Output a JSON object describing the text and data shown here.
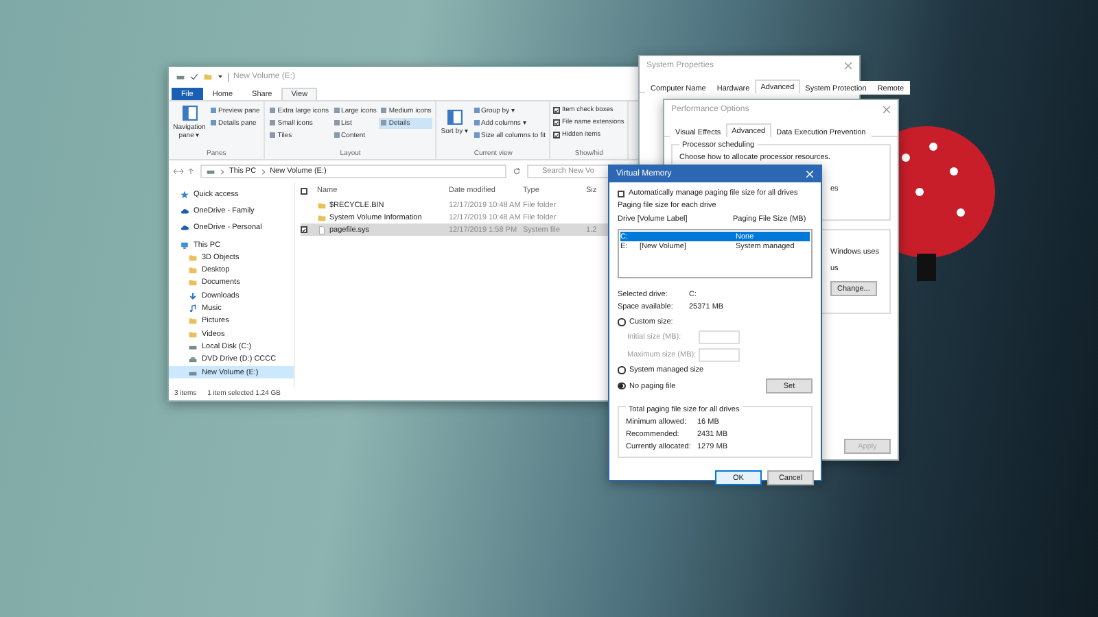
{
  "explorer": {
    "title": "New Volume (E:)",
    "ribbon_tabs": [
      {
        "label": "File",
        "kind": "file",
        "selected": false
      },
      {
        "label": "Home",
        "kind": "tab",
        "selected": false
      },
      {
        "label": "Share",
        "kind": "tab",
        "selected": false
      },
      {
        "label": "View",
        "kind": "tab",
        "selected": true
      }
    ],
    "ribbon_groups": [
      {
        "label": "Panes",
        "items": [
          {
            "kind": "big",
            "label": "Navigation pane ▾"
          },
          {
            "kind": "small",
            "label": "Preview pane"
          },
          {
            "kind": "small",
            "label": "Details pane"
          }
        ]
      },
      {
        "label": "Layout",
        "items": [
          {
            "kind": "choice",
            "label": "Extra large icons",
            "selected": false
          },
          {
            "kind": "choice",
            "label": "Small icons",
            "selected": false
          },
          {
            "kind": "choice",
            "label": "Tiles",
            "selected": false
          },
          {
            "kind": "choice",
            "label": "Large icons",
            "selected": false
          },
          {
            "kind": "choice",
            "label": "List",
            "selected": false
          },
          {
            "kind": "choice",
            "label": "Content",
            "selected": false
          },
          {
            "kind": "choice",
            "label": "Medium icons",
            "selected": false
          },
          {
            "kind": "choice",
            "label": "Details",
            "selected": true
          }
        ]
      },
      {
        "label": "Current view",
        "items": [
          {
            "kind": "big",
            "label": "Sort by ▾"
          },
          {
            "kind": "small",
            "label": "Group by ▾"
          },
          {
            "kind": "small",
            "label": "Add columns ▾"
          },
          {
            "kind": "small",
            "label": "Size all columns to fit"
          }
        ]
      },
      {
        "label": "Show/hid",
        "items": [
          {
            "kind": "check",
            "label": "Item check boxes",
            "checked": true
          },
          {
            "kind": "check",
            "label": "File name extensions",
            "checked": true
          },
          {
            "kind": "check",
            "label": "Hidden items",
            "checked": true
          }
        ]
      }
    ],
    "path": [
      "This PC",
      "New Volume (E:)"
    ],
    "search": {
      "placeholder": "Search New Vo"
    },
    "nav": [
      {
        "label": "Quick access",
        "kind": "star",
        "selected": false
      },
      {
        "label": "OneDrive - Family",
        "kind": "cloud",
        "selected": false
      },
      {
        "label": "OneDrive - Personal",
        "kind": "cloud",
        "selected": false
      },
      {
        "label": "This PC",
        "kind": "pc",
        "selected": false,
        "children": [
          {
            "label": "3D Objects",
            "kind": "folder",
            "selected": false
          },
          {
            "label": "Desktop",
            "kind": "folder",
            "selected": false
          },
          {
            "label": "Documents",
            "kind": "folder",
            "selected": false
          },
          {
            "label": "Downloads",
            "kind": "download",
            "selected": false
          },
          {
            "label": "Music",
            "kind": "music",
            "selected": false
          },
          {
            "label": "Pictures",
            "kind": "folder",
            "selected": false
          },
          {
            "label": "Videos",
            "kind": "folder",
            "selected": false
          },
          {
            "label": "Local Disk (C:)",
            "kind": "drive",
            "selected": false
          },
          {
            "label": "DVD Drive (D:) CCCC",
            "kind": "disc",
            "selected": false
          },
          {
            "label": "New Volume (E:)",
            "kind": "drive",
            "selected": true
          }
        ]
      }
    ],
    "select_all_checked": false,
    "columns": [
      "Name",
      "Date modified",
      "Type",
      "Siz"
    ],
    "rows": [
      {
        "name": "$RECYCLE.BIN",
        "kind": "folder",
        "date": "12/17/2019 10:48 AM",
        "type": "File folder",
        "selected": false
      },
      {
        "name": "System Volume Information",
        "kind": "folder",
        "date": "12/17/2019 10:48 AM",
        "type": "File folder",
        "selected": false
      },
      {
        "name": "pagefile.sys",
        "kind": "file",
        "date": "12/17/2019 1:58 PM",
        "type": "System file",
        "size": "1.2",
        "selected": true
      }
    ],
    "status": [
      "3 items",
      "1 item selected  1.24 GB"
    ]
  },
  "system_properties": {
    "title": "System Properties",
    "tabs": [
      {
        "label": "Computer Name",
        "selected": false
      },
      {
        "label": "Hardware",
        "selected": false
      },
      {
        "label": "Advanced",
        "selected": true
      },
      {
        "label": "System Protection",
        "selected": false
      },
      {
        "label": "Remote",
        "selected": false
      }
    ]
  },
  "performance_options": {
    "title": "Performance Options",
    "tabs": [
      {
        "label": "Visual Effects",
        "selected": false
      },
      {
        "label": "Advanced",
        "selected": true
      },
      {
        "label": "Data Execution Prevention",
        "selected": false
      }
    ],
    "group_title": "Processor scheduling",
    "group_text": "Choose how to allocate processor resources.",
    "fragment_1": "es",
    "fragment_2": "Windows uses",
    "fragment_3": "us",
    "change_button": "Change...",
    "apply_button": "Apply",
    "apply_disabled": true
  },
  "virtual_memory": {
    "title": "Virtual Memory",
    "auto_label": "Automatically manage paging file size for all drives",
    "auto_checked": false,
    "list_title": "Paging file size for each drive",
    "list_columns": [
      "Drive  [Volume Label]",
      "Paging File Size (MB)"
    ],
    "drives": [
      {
        "drive": "C:",
        "size": "None",
        "selected": true
      },
      {
        "drive": "E:",
        "label": "[New Volume]",
        "size": "System managed",
        "selected": false
      }
    ],
    "info": [
      {
        "label": "Selected drive:",
        "value": "C:"
      },
      {
        "label": "Space available:",
        "value": "25371 MB"
      }
    ],
    "custom": {
      "label": "Custom size:",
      "selected": false
    },
    "fields": [
      {
        "label": "Initial size (MB):",
        "disabled": true
      },
      {
        "label": "Maximum size (MB):",
        "disabled": true
      }
    ],
    "options": [
      {
        "label": "System managed size",
        "selected": false
      },
      {
        "label": "No paging file",
        "selected": true
      }
    ],
    "set_button": "Set",
    "total_title": "Total paging file size for all drives",
    "totals": [
      {
        "label": "Minimum allowed:",
        "value": "16 MB"
      },
      {
        "label": "Recommended:",
        "value": "2431 MB"
      },
      {
        "label": "Currently allocated:",
        "value": "1279 MB"
      }
    ],
    "buttons": [
      "OK",
      "Cancel"
    ]
  }
}
